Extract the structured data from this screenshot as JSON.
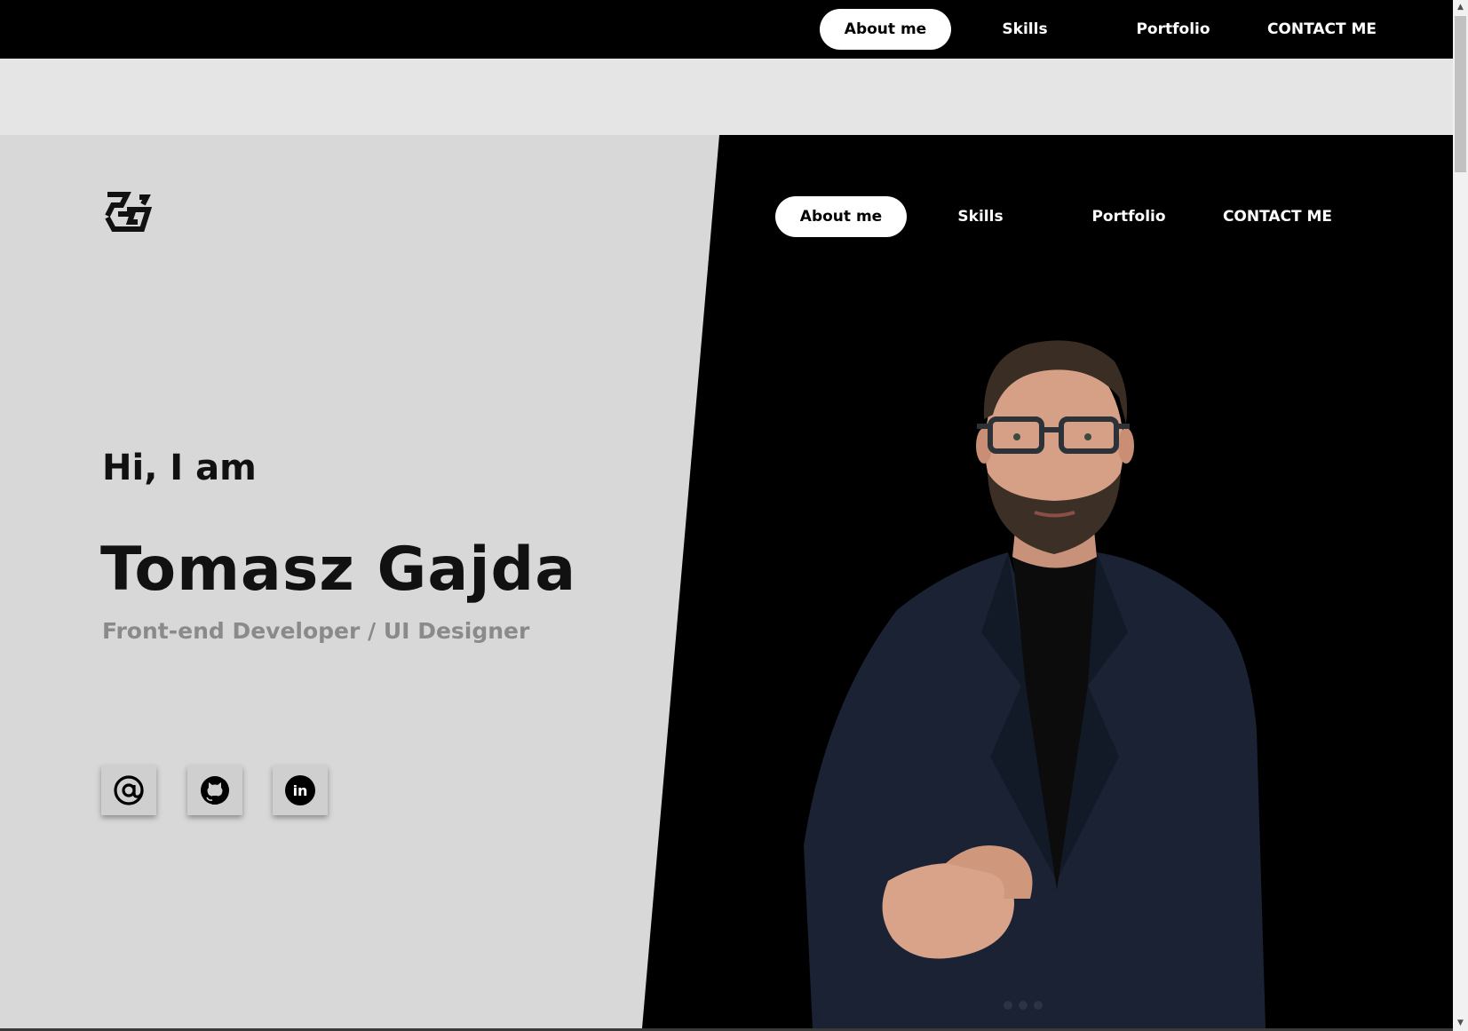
{
  "top_nav": {
    "items": [
      {
        "label": "About me",
        "active": true
      },
      {
        "label": "Skills",
        "active": false
      },
      {
        "label": "Portfolio",
        "active": false
      },
      {
        "label": "CONTACT ME",
        "active": false
      }
    ]
  },
  "hero": {
    "logo_icon": "tg-monogram-icon",
    "nav": {
      "items": [
        {
          "label": "About me",
          "active": true
        },
        {
          "label": "Skills",
          "active": false
        },
        {
          "label": "Portfolio",
          "active": false
        },
        {
          "label": "CONTACT ME",
          "active": false
        }
      ]
    },
    "greeting": "Hi, I am",
    "name": "Tomasz Gajda",
    "role": "Front-end Developer / UI Designer",
    "social": [
      {
        "icon": "at-sign-icon"
      },
      {
        "icon": "github-icon"
      },
      {
        "icon": "linkedin-icon"
      }
    ]
  },
  "colors": {
    "nav_bg": "#000000",
    "hero_left_bg": "#d8d8d8",
    "hero_right_bg": "#000000",
    "role_text": "#8a8a8a",
    "active_pill": "#ffffff"
  }
}
